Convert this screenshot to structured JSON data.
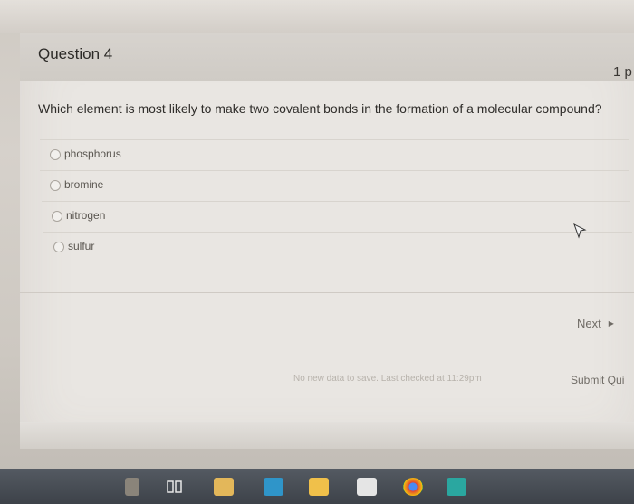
{
  "question": {
    "title": "Question 4",
    "points": "1 p",
    "text": "Which element is most likely to make two covalent bonds in the formation of a molecular compound?",
    "answers": [
      {
        "label": "phosphorus"
      },
      {
        "label": "bromine"
      },
      {
        "label": "nitrogen"
      },
      {
        "label": "sulfur"
      }
    ]
  },
  "footer": {
    "next_label": "Next",
    "status": "No new data to save. Last checked at 11:29pm",
    "submit_label": "Submit Qui"
  },
  "taskbar": {
    "icons": [
      "recycle-icon",
      "task-view-icon",
      "folder-icon",
      "store-icon",
      "mail-icon",
      "chrome-icon",
      "app-icon"
    ]
  },
  "colors": {
    "card": "#e9e6e2",
    "header": "#d3cfc9",
    "taskbar": "#4a4f56"
  }
}
